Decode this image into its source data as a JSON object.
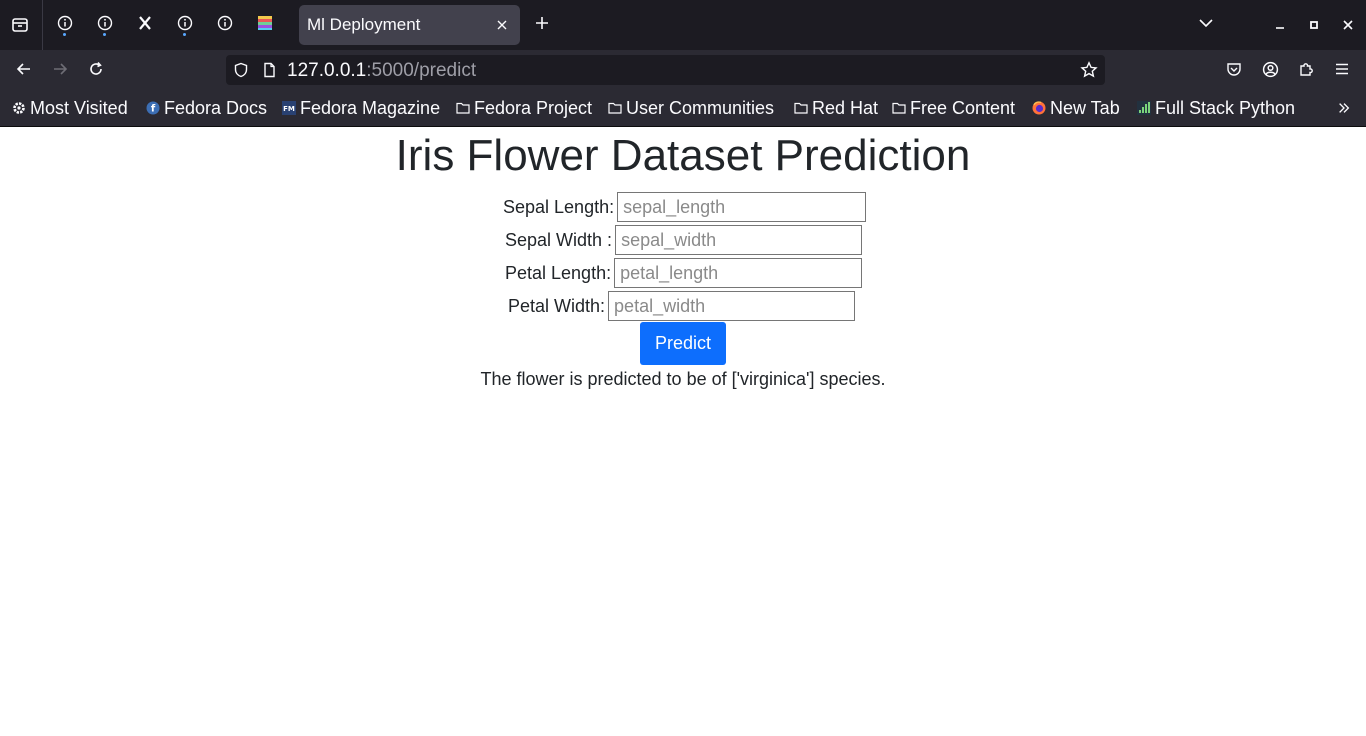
{
  "browser": {
    "active_tab": {
      "title": "Ml Deployment"
    },
    "pinned_tabs": [
      {
        "icon": "info-icon",
        "indicator": true
      },
      {
        "icon": "info-icon",
        "indicator": true
      },
      {
        "icon": "x-logo-icon",
        "indicator": false
      },
      {
        "icon": "info-icon",
        "indicator": true
      },
      {
        "icon": "info-icon",
        "indicator": false
      },
      {
        "icon": "colorful-favicon-icon",
        "indicator": false
      }
    ],
    "url": {
      "host": "127.0.0.1",
      "rest": ":5000/predict"
    },
    "bookmarks": [
      {
        "label": "Most Visited",
        "icon": "gear-icon"
      },
      {
        "label": "Fedora Docs",
        "icon": "fedora-icon"
      },
      {
        "label": "Fedora Magazine",
        "icon": "fedora-magazine-icon"
      },
      {
        "label": "Fedora Project",
        "icon": "folder-icon"
      },
      {
        "label": "User Communities",
        "icon": "folder-icon"
      },
      {
        "label": "Red Hat",
        "icon": "folder-icon"
      },
      {
        "label": "Free Content",
        "icon": "folder-icon"
      },
      {
        "label": "New Tab",
        "icon": "firefox-icon"
      },
      {
        "label": "Full Stack Python",
        "icon": "fullstackpython-icon"
      }
    ],
    "colors": {
      "tabstrip": "#1c1b22",
      "toolbar": "#2b2a33",
      "accent": "#0d6efd"
    }
  },
  "page": {
    "title": "Iris Flower Dataset Prediction",
    "fields": [
      {
        "label": "Sepal Length:",
        "placeholder": "sepal_length",
        "value": ""
      },
      {
        "label": "Sepal Width :",
        "placeholder": "sepal_width",
        "value": ""
      },
      {
        "label": "Petal Length:",
        "placeholder": "petal_length",
        "value": ""
      },
      {
        "label": "Petal Width:",
        "placeholder": "petal_width",
        "value": ""
      }
    ],
    "button_label": "Predict",
    "result": "The flower is predicted to be of ['virginica'] species."
  }
}
